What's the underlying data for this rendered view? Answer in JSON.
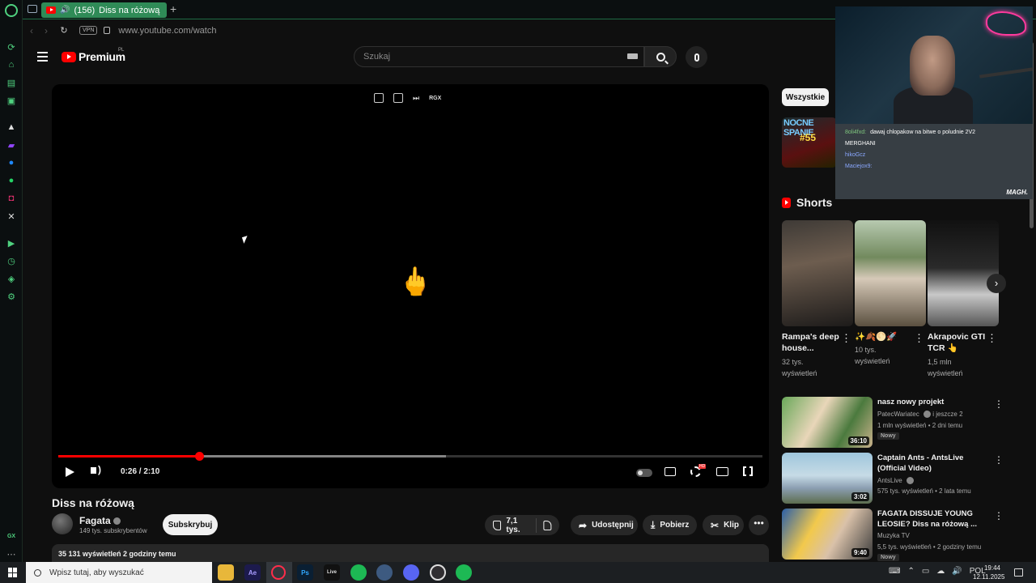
{
  "browser": {
    "tab": {
      "count": "(156)",
      "title": "Diss na różową"
    },
    "url": "www.youtube.com/watch",
    "vpn_label": "VPN"
  },
  "sidebar_icons": [
    "opera-gx-logo",
    "speed-dial-icon",
    "bag-icon",
    "twitch-icon",
    "music-icon",
    "aria-icon",
    "twitch-icon",
    "messenger-icon",
    "whatsapp-icon",
    "instagram-icon",
    "x-icon",
    "player-icon",
    "history-icon",
    "extensions-icon",
    "settings-icon",
    "gx-label-icon",
    "more-icon"
  ],
  "header": {
    "logo_text": "Premium",
    "logo_region": "PL",
    "search_placeholder": "Szukaj"
  },
  "player": {
    "top_controls": [
      "popout-icon",
      "share-icon",
      "skip-icon",
      "RGX"
    ],
    "current_time": "0:26",
    "duration": "2:10",
    "time_display": "0:26 / 2:10",
    "played_fraction": 0.2,
    "buffered_fraction": 0.55,
    "hd_badge": "HD"
  },
  "video": {
    "title": "Diss na różową",
    "channel": "Fagata",
    "subscribers": "149 tys. subskrybentów",
    "subscribe_label": "Subskrybuj",
    "likes": "7,1 tys.",
    "share_label": "Udostępnij",
    "download_label": "Pobierz",
    "clip_label": "Klip",
    "more_label": "•••",
    "views_line": "35 131 wyświetleń  2 godziny temu"
  },
  "sidebar_right": {
    "chip_all": "Wszystkie",
    "thumb_text_1": "NOCNE SPANIE",
    "thumb_text_2": "#55",
    "shorts_title": "Shorts",
    "shorts": [
      {
        "title": "Rampa's deep house...",
        "views": "32 tys. wyświetleń"
      },
      {
        "title": "✨🍂🌕🚀",
        "views": "10 tys. wyświetleń"
      },
      {
        "title": "Akrapovic GTI TCR 👆",
        "views": "1,5 mln wyświetleń"
      }
    ],
    "recommendations": [
      {
        "title": "nasz nowy projekt",
        "channel": "PatecWariatec",
        "channel_suffix": "i jeszcze 2",
        "meta": "1 mln wyświetleń • 2 dni temu",
        "badge": "Nowy",
        "duration": "36:10"
      },
      {
        "title": "Captain Ants - AntsLive (Official Video)",
        "channel": "AntsLive",
        "channel_suffix": "",
        "meta": "575 tys. wyświetleń • 2 lata temu",
        "badge": "",
        "duration": "3:02"
      },
      {
        "title": "FAGATA DISSUJE YOUNG LEOSIE? Diss na różową ...",
        "channel": "Muzyka TV",
        "channel_suffix": "",
        "meta": "5,5 tys. wyświetleń • 2 godziny temu",
        "badge": "Nowy",
        "duration": "9:40"
      }
    ]
  },
  "stream_overlay": {
    "chat": [
      {
        "user": "8oli4fxd:",
        "text": "dawaj chlopakow na bitwe o poludnie 2V2"
      },
      {
        "user": "",
        "text": "MERGHANI"
      },
      {
        "user": "hikoGcz",
        "text": ""
      },
      {
        "user": "Maciejox9:",
        "text": ""
      }
    ],
    "brand": "MAGH."
  },
  "taskbar": {
    "search_placeholder": "Wpisz tutaj, aby wyszukać",
    "apps": [
      "file-explorer-icon",
      "after-effects-icon",
      "opera-gx-icon",
      "photoshop-icon",
      "live-icon",
      "spotify-icon",
      "ccleaner-icon",
      "discord-icon",
      "obs-icon",
      "spotify-icon"
    ],
    "app_labels": {
      "ae": "Ae",
      "ps": "Ps",
      "live": "Live"
    },
    "lang": "POL",
    "time": "19:44",
    "date": "12.11.2025"
  },
  "colors": {
    "accent_gx": "#4fd17f",
    "tab_active": "#2f8b57",
    "yt_red": "#ff0000",
    "background": "#0f0f0f"
  }
}
